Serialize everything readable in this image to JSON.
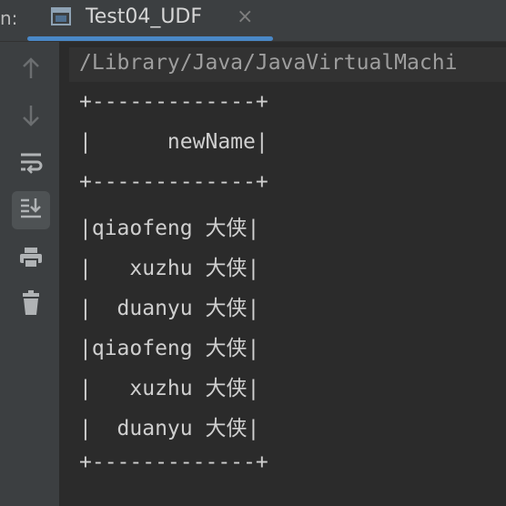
{
  "run_label": "n:",
  "tab": {
    "title": "Test04_UDF",
    "close_glyph": "×"
  },
  "toolbar": {
    "buttons": [
      {
        "icon": "up-arrow-icon"
      },
      {
        "icon": "down-arrow-icon"
      },
      {
        "icon": "soft-wrap-icon"
      },
      {
        "icon": "scroll-to-end-icon"
      },
      {
        "icon": "print-icon"
      },
      {
        "icon": "trash-icon"
      }
    ]
  },
  "console": {
    "path": "/Library/Java/JavaVirtualMachi",
    "lines": [
      "+-------------+",
      "|      newName|",
      "+-------------+",
      "|qiaofeng 大侠|",
      "|   xuzhu 大侠|",
      "|  duanyu 大侠|",
      "|qiaofeng 大侠|",
      "|   xuzhu 大侠|",
      "|  duanyu 大侠|",
      "+-------------+"
    ]
  },
  "colors": {
    "accent": "#4a88c7",
    "background": "#2b2b2b",
    "panel": "#3c3f41",
    "text": "#cfcfcf"
  }
}
